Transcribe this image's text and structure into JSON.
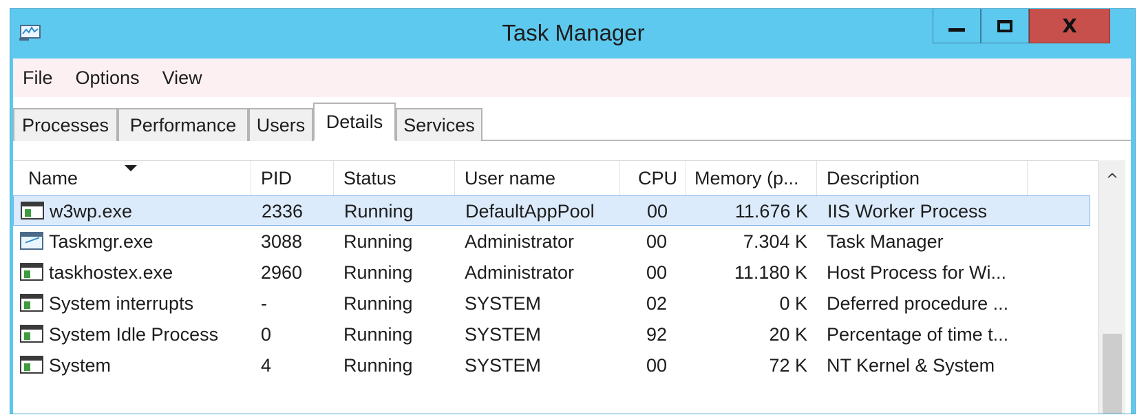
{
  "window": {
    "title": "Task Manager",
    "icons": {
      "app": "task-manager-icon",
      "minimize": "minimize-icon",
      "maximize": "maximize-icon",
      "close": "close-icon"
    },
    "close_symbol": "X"
  },
  "menu": [
    "File",
    "Options",
    "View"
  ],
  "tabs": {
    "items": [
      "Processes",
      "Performance",
      "Users",
      "Details",
      "Services"
    ],
    "active": "Details"
  },
  "table": {
    "columns": [
      "Name",
      "PID",
      "Status",
      "User name",
      "CPU",
      "Memory (p...",
      "Description"
    ],
    "sorted_by": "Name",
    "rows": [
      {
        "name": "w3wp.exe",
        "pid": "2336",
        "status": "Running",
        "user": "DefaultAppPool",
        "cpu": "00",
        "memory": "11.676 K",
        "description": "IIS Worker Process",
        "icon": "process-icon"
      },
      {
        "name": "Taskmgr.exe",
        "pid": "3088",
        "status": "Running",
        "user": "Administrator",
        "cpu": "00",
        "memory": "7.304 K",
        "description": "Task Manager",
        "icon": "task-manager-icon"
      },
      {
        "name": "taskhostex.exe",
        "pid": "2960",
        "status": "Running",
        "user": "Administrator",
        "cpu": "00",
        "memory": "11.180 K",
        "description": "Host Process for Wi...",
        "icon": "process-icon"
      },
      {
        "name": "System interrupts",
        "pid": "-",
        "status": "Running",
        "user": "SYSTEM",
        "cpu": "02",
        "memory": "0 K",
        "description": "Deferred procedure ...",
        "icon": "process-icon"
      },
      {
        "name": "System Idle Process",
        "pid": "0",
        "status": "Running",
        "user": "SYSTEM",
        "cpu": "92",
        "memory": "20 K",
        "description": "Percentage of time t...",
        "icon": "process-icon"
      },
      {
        "name": "System",
        "pid": "4",
        "status": "Running",
        "user": "SYSTEM",
        "cpu": "00",
        "memory": "72 K",
        "description": "NT Kernel & System",
        "icon": "process-icon"
      }
    ],
    "selected_row": "w3wp.exe"
  },
  "scrollbar": {
    "up_symbol": "^"
  },
  "colors": {
    "titlebar": "#5ec9ee",
    "close_button": "#c7504c",
    "menubar": "#fdf0f2",
    "selection": "#dcebfc"
  }
}
